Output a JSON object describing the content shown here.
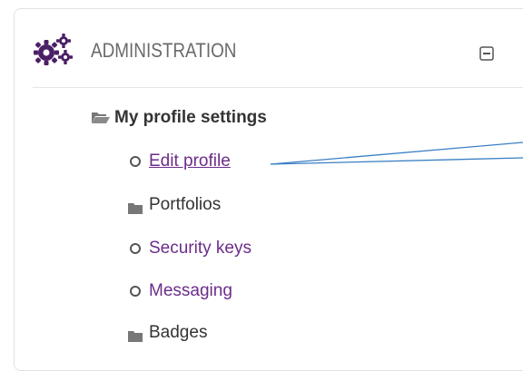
{
  "block": {
    "title": "ADMINISTRATION",
    "icon": "gears-icon",
    "collapse_icon": "collapse-icon"
  },
  "tree": {
    "section_label": "My profile settings",
    "section_icon": "folder-open-icon",
    "items": [
      {
        "label": "Edit profile",
        "icon": "circle-icon",
        "is_link": true
      },
      {
        "label": "Portfolios",
        "icon": "folder-icon",
        "is_link": false
      },
      {
        "label": "Security keys",
        "icon": "circle-icon",
        "is_link": true
      },
      {
        "label": "Messaging",
        "icon": "circle-icon",
        "is_link": true
      },
      {
        "label": "Badges",
        "icon": "folder-icon",
        "is_link": false
      }
    ]
  },
  "colors": {
    "accent": "#6b2d8a",
    "header_text": "#6a6a6a",
    "callout_line": "#3a7fc4"
  }
}
